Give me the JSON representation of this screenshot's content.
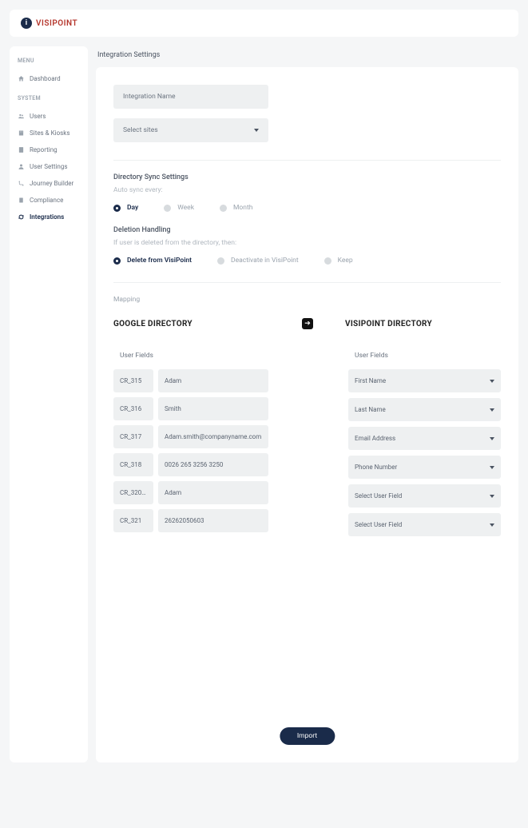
{
  "brand": {
    "name": "VISIPOINT"
  },
  "sidebar": {
    "menu_label": "MENU",
    "system_label": "SYSTEM",
    "items_menu": [
      {
        "label": "Dashboard"
      }
    ],
    "items_system": [
      {
        "label": "Users"
      },
      {
        "label": "Sites & Kiosks"
      },
      {
        "label": "Reporting"
      },
      {
        "label": "User Settings"
      },
      {
        "label": "Journey Builder"
      },
      {
        "label": "Compliance"
      },
      {
        "label": "Integrations"
      }
    ]
  },
  "page": {
    "title": "Integration Settings"
  },
  "form": {
    "name_placeholder": "Integration Name",
    "sites_placeholder": "Select sites"
  },
  "sync": {
    "title": "Directory Sync Settings",
    "sub": "Auto sync every:",
    "options": [
      "Day",
      "Week",
      "Month"
    ],
    "selected": "Day"
  },
  "deletion": {
    "title": "Deletion Handling",
    "sub": "If user is deleted from the directory, then:",
    "options": [
      "Delete from VisiPoint",
      "Deactivate in VisiPoint",
      "Keep"
    ],
    "selected": "Delete from VisiPoint"
  },
  "mapping": {
    "label": "Mapping",
    "left_title": "GOOGLE DIRECTORY",
    "right_title": "VISIPOINT DIRECTORY",
    "user_fields_label": "User Fields",
    "google_rows": [
      {
        "code": "CR_315",
        "value": "Adam"
      },
      {
        "code": "CR_316",
        "value": "Smith"
      },
      {
        "code": "CR_317",
        "value": "Adam.smith@companyname.com"
      },
      {
        "code": "CR_318",
        "value": "0026 265 3256 3250"
      },
      {
        "code": "CR_320 ...",
        "value": "Adam"
      },
      {
        "code": "CR_321",
        "value": "26262050603"
      }
    ],
    "visipoint_rows": [
      "First Name",
      "Last Name",
      "Email Address",
      "Phone Number",
      "Select User Field",
      "Select User Field"
    ]
  },
  "actions": {
    "import": "Import"
  }
}
